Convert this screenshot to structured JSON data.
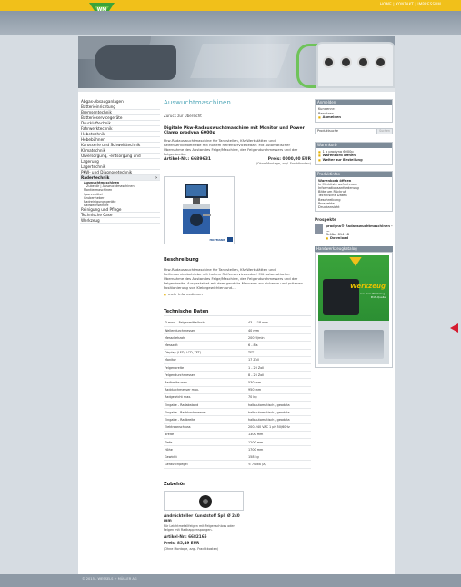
{
  "top_links": "HOME | KONTAKT | IMPRESSUM",
  "colors": {
    "accent": "#f1c01a",
    "heading": "#51a7b8",
    "arrow": "#d51c30"
  },
  "nav": {
    "items": [
      "Abgas-Absauganlagen",
      "Batterieinrichtung",
      "Bremsentechnik",
      "Batterieservicegeräte",
      "Druckluftechnik",
      "Fahrwerktechnik",
      "Hebetechnik",
      "Hebebühnen",
      "Karosserie und Schweißtechnik",
      "Klimatechnik",
      "Ölversorgung, -entsorgung und",
      "Lagerung",
      "Lagertechnik",
      "PKW- und Diagnosetechnik",
      "Radertechnik"
    ],
    "subitems": [
      "Auswuchtmaschinen",
      "Zubehör | Auswuchtmaschinen",
      "Montiermaschinen",
      "Spannmittel",
      "Grubenheber",
      "Radreinigungsgeräte",
      "Radwechselhilfe"
    ],
    "bottom_items": [
      "Reinigung und Pflege",
      "Technische Case",
      "Werkzeug"
    ]
  },
  "main": {
    "heading": "Auswuchtmaschinen",
    "back": "Zurück zur Übersicht",
    "product_title": "Digitale Pkw-Radauswuchtmaschine mit Monitor und Power Clamp prodyna 6000p",
    "product_desc": "Pkw-Radauswuchtmaschine für Tankstellen, Kfz-Werkstätten und Reifenservicebetriebe mit hohem Reifenservicebedarf. Mit automatischer Übernahme des Abstandes Felge/Maschine, des Felgendurchmessers und der Felgenbreite.",
    "article": "Artikel-Nr.: 6689631",
    "price": "Preis: 0000,00 EUR",
    "price_note": "(Ohne Montage, zzgl. Frachtkosten)",
    "brand": "HOFMANN",
    "desc_heading": "Beschreibung",
    "desc_text": "Pkw-Radauswuchtmaschine für Tankstellen, Kfz-Werkstätten und Reifenservicebetriebe mit hohem Reifenservicebedarf. Mit automatischer Übernahme des Abstandes Felge/Maschine, des Felgendurchmessers und der Felgenbreite. Ausgestattet mit dem geodata-Messarm zur sicheren und präzisen Positionierung von Klebegewichten und...",
    "more_info": "mehr Informationen",
    "tech_heading": "Technische Daten",
    "tech": [
      [
        "Ø max. - Felgenmittelloch",
        "43 - 118 mm"
      ],
      [
        "Wellendurchmesser",
        "40 mm"
      ],
      [
        "Messdrehzahl",
        "200 U/min"
      ],
      [
        "Messzeit",
        "6 - 8 s"
      ],
      [
        "Display (LED, LCD, TFT)",
        "TFT"
      ],
      [
        "Monitor",
        "17 Zoll"
      ],
      [
        "Felgenbreite",
        "1 - 20 Zoll"
      ],
      [
        "Felgendurchmesser",
        "8 - 25 Zoll"
      ],
      [
        "Radbreite max.",
        "530 mm"
      ],
      [
        "Raddurchmesser max.",
        "950 mm"
      ],
      [
        "Radgewicht max.",
        "70 kg"
      ],
      [
        "Eingabe - Radabstand",
        "halbautomatisch / geodata"
      ],
      [
        "Eingabe - Raddurchmesser",
        "halbautomatisch / geodata"
      ],
      [
        "Eingabe - Radbreite",
        "halbautomatisch / geodata"
      ],
      [
        "Elektroanschluss",
        "200-240 VAC 1 ph 50/60Hz"
      ],
      [
        "Breite",
        "1300 mm"
      ],
      [
        "Tiefe",
        "1200 mm"
      ],
      [
        "Höhe",
        "1700 mm"
      ],
      [
        "Gewicht",
        "158 kg"
      ],
      [
        "Geräuschpegel",
        "< 70 dB (A)"
      ]
    ],
    "zubehoer_heading": "Zubehör",
    "zubehoer_title": "Andrückteller Kunststoff Spl. Ø 240 mm",
    "zubehoer_desc": "Für Leichtmetallfelgen mit Felgenschloss oder Felgen mit Radkappenspangen.",
    "zubehoer_article": "Artikel-Nr.: 6682165",
    "zubehoer_price": "Preis: 85,49 EUR",
    "zubehoer_note": "(Ohne Montage, zzgl. Frachtkosten)"
  },
  "right": {
    "login_heading": "Anmelden",
    "login_lines": [
      "Kundennr:",
      "Benutzer:"
    ],
    "login_button": "Anmelden",
    "search_placeholder": "Produktsuche",
    "search_button": "Suchen",
    "cart_heading": "Warenkorb",
    "cart_lines": [
      "1 x prodyna 6000p"
    ],
    "cart_open": "Warenkorb öffnen",
    "cart_order": "Weiter zur Bestellung",
    "info_heading": "Produktinfos",
    "info_items": [
      "Warenkorb öffnen",
      "In Merkliste aufnehmen",
      "Informationsanforderung",
      "Bitte um Rückruf",
      "Technische Daten",
      "Beschreibung",
      "Prospekte",
      "Druckansicht"
    ],
    "prospekte_heading": "Prospekte",
    "prospekt_title": "prodyna® Radauswuchtmaschinen - ...",
    "prospekt_size": "Größe: 814 kB",
    "prospekt_download": "Download",
    "katalog_heading": "Handwerkzeugkatalog",
    "katalog_title": "Werkzeug",
    "katalog_sub": "aus Ihrer Werkzeug-Profi-Quelle"
  },
  "footer": "© 2015 - WESSELS + MÜLLER AG"
}
